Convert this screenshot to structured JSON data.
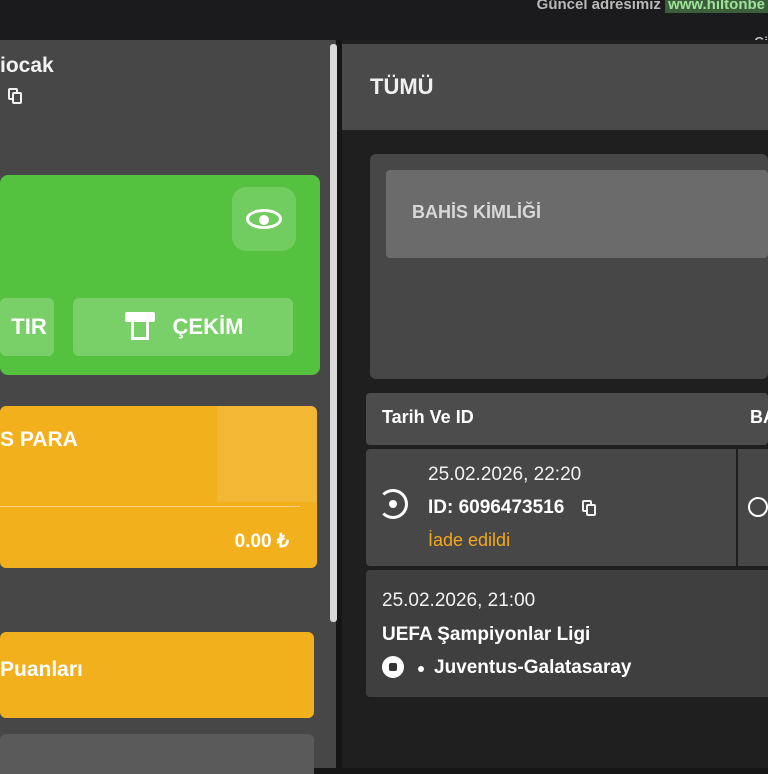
{
  "topbar": {
    "notice_text": "Güncel adresimiz",
    "notice_link": "www.hiltonbe",
    "sub_text": "Gi"
  },
  "account": {
    "username": "iocak"
  },
  "balance_card": {
    "deposit_label": "TIR",
    "withdraw_label": "ÇEKİM"
  },
  "bonus_card": {
    "title": "S PARA",
    "amount": "0.00 ₺"
  },
  "points_card": {
    "title": "Puanları"
  },
  "tabs": {
    "all_label": "TÜMÜ"
  },
  "filter": {
    "bet_id_placeholder": "BAHİS KİMLİĞİ"
  },
  "table": {
    "col_date_id": "Tarih Ve ID",
    "col_second": "BA"
  },
  "bet": {
    "datetime": "25.02.2026, 22:20",
    "id": "ID: 6096473516",
    "status": "İade edildi",
    "event_datetime": "25.02.2026, 21:00",
    "league": "UEFA Şampiyonlar Ligi",
    "match": "Juventus-Galatasaray"
  },
  "colors": {
    "green_card": "#54c23e",
    "yellow_card": "#f2b01c",
    "status_refunded": "#f2a81c"
  }
}
